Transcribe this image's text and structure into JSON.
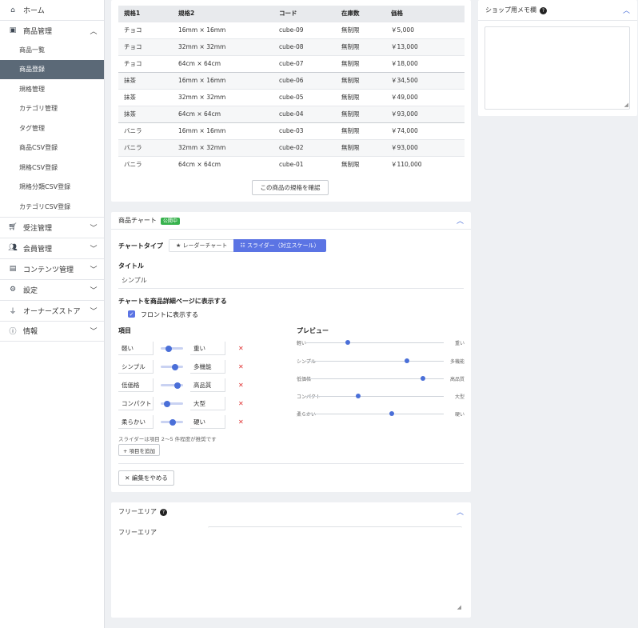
{
  "sidebar": {
    "home": "ホーム",
    "product_mgmt": "商品管理",
    "sub_items": [
      "商品一覧",
      "商品登録",
      "規格管理",
      "カテゴリ管理",
      "タグ管理",
      "商品CSV登録",
      "規格CSV登録",
      "規格分類CSV登録",
      "カテゴリCSV登録"
    ],
    "order_mgmt": "受注管理",
    "member_mgmt": "会員管理",
    "content_mgmt": "コンテンツ管理",
    "settings": "設定",
    "owners_store": "オーナーズストア",
    "info": "情報"
  },
  "spec_table": {
    "headers": [
      "規格1",
      "規格2",
      "コード",
      "在庫数",
      "価格"
    ],
    "rows": [
      [
        "チョコ",
        "16mm × 16mm",
        "cube-09",
        "無制限",
        "￥5,000"
      ],
      [
        "チョコ",
        "32mm × 32mm",
        "cube-08",
        "無制限",
        "￥13,000"
      ],
      [
        "チョコ",
        "64cm × 64cm",
        "cube-07",
        "無制限",
        "￥18,000"
      ],
      [
        "抹茶",
        "16mm × 16mm",
        "cube-06",
        "無制限",
        "￥34,500"
      ],
      [
        "抹茶",
        "32mm × 32mm",
        "cube-05",
        "無制限",
        "￥49,000"
      ],
      [
        "抹茶",
        "64cm × 64cm",
        "cube-04",
        "無制限",
        "￥93,000"
      ],
      [
        "バニラ",
        "16mm × 16mm",
        "cube-03",
        "無制限",
        "￥74,000"
      ],
      [
        "バニラ",
        "32mm × 32mm",
        "cube-02",
        "無制限",
        "￥93,000"
      ],
      [
        "バニラ",
        "64cm × 64cm",
        "cube-01",
        "無制限",
        "￥110,000"
      ]
    ],
    "confirm_button": "この商品の規格を確認"
  },
  "chart_card": {
    "title": "商品チャート",
    "badge": "公開中",
    "chart_type_label": "チャートタイプ",
    "type_options": [
      "★ レーダーチャート",
      "☷ スライダー（対立スケール）"
    ],
    "title_label": "タイトル",
    "title_value": "シンプル",
    "display_label": "チャートを商品詳細ページに表示する",
    "front_display": "フロントに表示する",
    "items_label": "項目",
    "items": [
      {
        "left": "軽い",
        "right": "重い",
        "level": 0.35
      },
      {
        "left": "シンプル",
        "right": "多機能",
        "level": 0.65
      },
      {
        "left": "低価格",
        "right": "高品質",
        "level": 0.75
      },
      {
        "left": "コンパクト",
        "right": "大型",
        "level": 0.3
      },
      {
        "left": "柔らかい",
        "right": "硬い",
        "level": 0.55
      }
    ],
    "slider_hint": "スライダーは項目 2〜5 件程度が推奨です",
    "add_item": "+ 項目を追加",
    "stop_edit": "✕ 編集をやめる",
    "preview_label": "プレビュー",
    "preview": [
      {
        "left": "軽い",
        "right": "重い",
        "level": 0.3
      },
      {
        "left": "シンプル",
        "right": "多機能",
        "level": 0.73
      },
      {
        "left": "低価格",
        "right": "高品質",
        "level": 0.85
      },
      {
        "left": "コンパクト",
        "right": "大型",
        "level": 0.38
      },
      {
        "left": "柔らかい",
        "right": "硬い",
        "level": 0.62
      }
    ]
  },
  "free_area": {
    "title": "フリーエリア",
    "label": "フリーエリア"
  },
  "shop_memo": {
    "title": "ショップ用メモ欄"
  }
}
